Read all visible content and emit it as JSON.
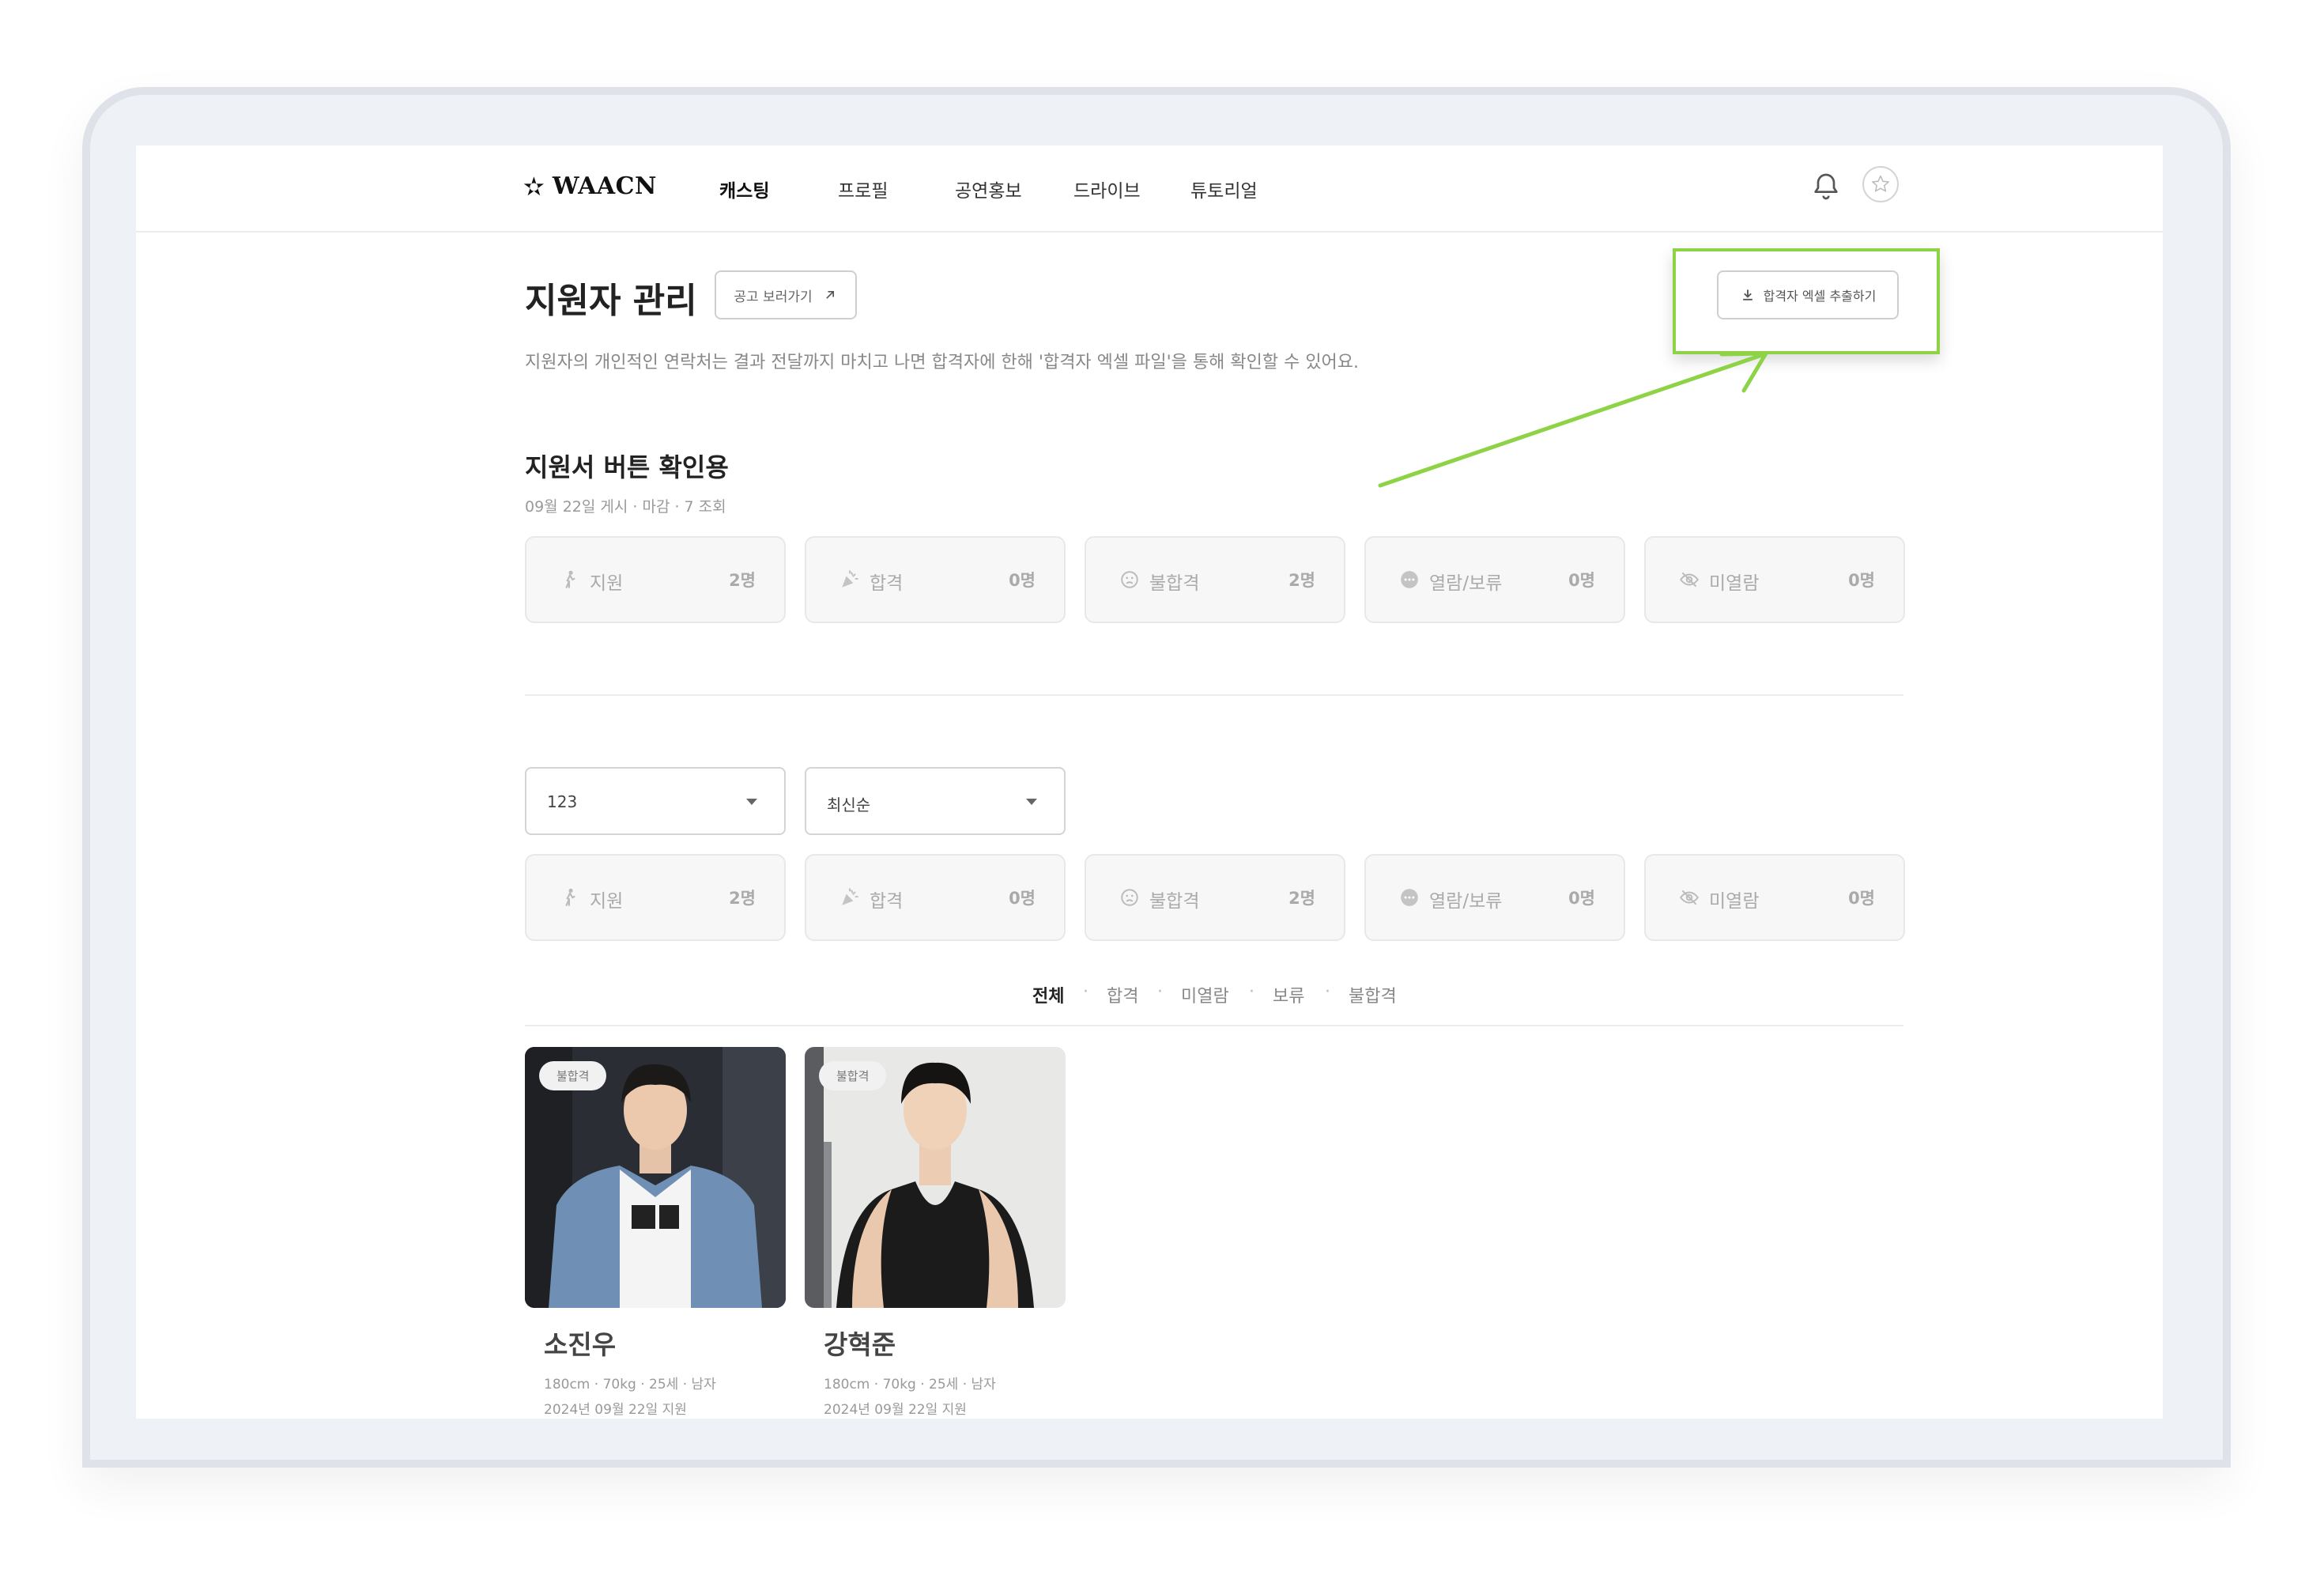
{
  "header": {
    "logo_text": "WAACN",
    "nav": [
      {
        "label": "캐스팅",
        "active": true
      },
      {
        "label": "프로필",
        "active": false
      },
      {
        "label": "공연홍보",
        "active": false
      },
      {
        "label": "드라이브",
        "active": false
      },
      {
        "label": "튜토리얼",
        "active": false
      }
    ]
  },
  "page": {
    "title": "지원자 관리",
    "view_post_label": "공고 보러가기",
    "description": "지원자의 개인적인 연락처는 결과 전달까지 마치고 나면 합격자에 한해 '합격자 엑셀 파일'을 통해 확인할 수 있어요.",
    "export_label": "합격자 엑셀 추출하기",
    "highlight_color": "#8ed345"
  },
  "posting": {
    "title": "지원서 버튼 확인용",
    "meta": "09월 22일 게시 · 마감 · 7 조회"
  },
  "stats_top": [
    {
      "icon": "person-icon",
      "label": "지원",
      "value": "2명"
    },
    {
      "icon": "party-popper-icon",
      "label": "합격",
      "value": "0명"
    },
    {
      "icon": "sad-face-icon",
      "label": "불합격",
      "value": "2명"
    },
    {
      "icon": "more-dots-icon",
      "label": "열람/보류",
      "value": "0명"
    },
    {
      "icon": "eye-off-icon",
      "label": "미열람",
      "value": "0명"
    }
  ],
  "filters": {
    "role_select": "123",
    "sort_select": "최신순"
  },
  "stats_bottom": [
    {
      "icon": "person-icon",
      "label": "지원",
      "value": "2명"
    },
    {
      "icon": "party-popper-icon",
      "label": "합격",
      "value": "0명"
    },
    {
      "icon": "sad-face-icon",
      "label": "불합격",
      "value": "2명"
    },
    {
      "icon": "more-dots-icon",
      "label": "열람/보류",
      "value": "0명"
    },
    {
      "icon": "eye-off-icon",
      "label": "미열람",
      "value": "0명"
    }
  ],
  "tabs": [
    {
      "label": "전체",
      "active": true
    },
    {
      "label": "합격",
      "active": false
    },
    {
      "label": "미열람",
      "active": false
    },
    {
      "label": "보류",
      "active": false
    },
    {
      "label": "불합격",
      "active": false
    }
  ],
  "tab_separator": "·",
  "applicants": [
    {
      "badge": "불합격",
      "name": "소진우",
      "info": "180cm · 70kg · 25세 · 남자",
      "date": "2024년 09월 22일 지원"
    },
    {
      "badge": "불합격",
      "name": "강혁준",
      "info": "180cm · 70kg · 25세 · 남자",
      "date": "2024년 09월 22일 지원"
    }
  ]
}
